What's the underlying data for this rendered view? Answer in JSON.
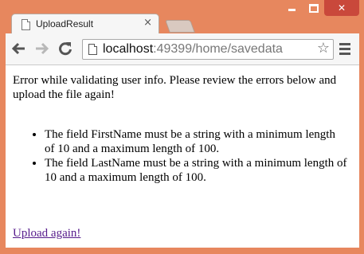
{
  "tab": {
    "title": "UploadResult",
    "close_glyph": "×"
  },
  "address_bar": {
    "host": "localhost",
    "path": ":49399/home/savedata"
  },
  "icons": {
    "page": "page-icon",
    "back": "back-arrow-icon",
    "forward": "forward-arrow-icon",
    "reload": "reload-icon",
    "bookmark": "star-icon",
    "menu": "hamburger-menu-icon"
  },
  "page": {
    "message": "Error while validating user info. Please review the errors below and upload the file again!",
    "errors": [
      "The field FirstName must be a string with a minimum length of 10 and a maximum length of 100.",
      "The field LastName must be a string with a minimum length of 10 and a maximum length of 100."
    ],
    "link_text": "Upload again!"
  },
  "colors": {
    "window_frame": "#e7875e",
    "close_button": "#c9483b",
    "visited_link": "#551a8b"
  }
}
